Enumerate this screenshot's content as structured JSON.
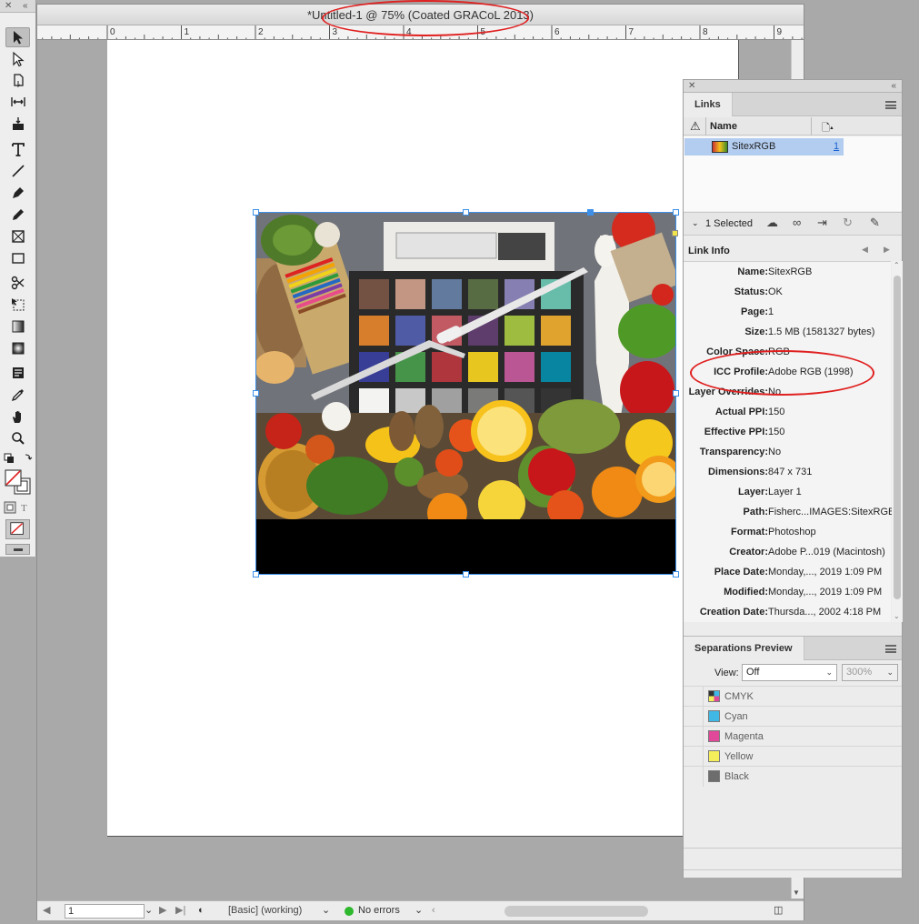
{
  "document": {
    "title": "*Untitled-1 @ 75% (Coated GRACoL 2013)",
    "ruler_ticks": [
      "0",
      "1",
      "2",
      "3",
      "4",
      "5",
      "6",
      "7",
      "8",
      "9"
    ]
  },
  "tools": [
    {
      "name": "selection-tool",
      "icon": "arrow-icon"
    },
    {
      "name": "direct-selection-tool",
      "icon": "hollow-arrow-icon"
    },
    {
      "name": "page-tool",
      "icon": "page-icon"
    },
    {
      "name": "gap-tool",
      "icon": "gap-icon"
    },
    {
      "name": "content-collector-tool",
      "icon": "collector-icon"
    },
    {
      "name": "type-tool",
      "icon": "type-icon"
    },
    {
      "name": "line-tool",
      "icon": "line-icon"
    },
    {
      "name": "pen-tool",
      "icon": "pen-icon"
    },
    {
      "name": "pencil-tool",
      "icon": "pencil-icon"
    },
    {
      "name": "rectangle-frame-tool",
      "icon": "frame-icon"
    },
    {
      "name": "rectangle-tool",
      "icon": "rectangle-icon"
    },
    {
      "name": "scissors-tool",
      "icon": "scissors-icon"
    },
    {
      "name": "free-transform-tool",
      "icon": "transform-icon"
    },
    {
      "name": "gradient-swatch-tool",
      "icon": "gradient-icon"
    },
    {
      "name": "gradient-feather-tool",
      "icon": "feather-icon"
    },
    {
      "name": "note-tool",
      "icon": "note-icon"
    },
    {
      "name": "eyedropper-tool",
      "icon": "eyedropper-icon"
    },
    {
      "name": "hand-tool",
      "icon": "hand-icon"
    },
    {
      "name": "zoom-tool",
      "icon": "zoom-icon"
    }
  ],
  "links_panel": {
    "tab": "Links",
    "column_name": "Name",
    "link": {
      "name": "SitexRGB",
      "page": "1"
    },
    "selected_label": "1 Selected",
    "link_info_label": "Link Info",
    "info": [
      {
        "key": "Name:",
        "value": "SitexRGB"
      },
      {
        "key": "Status:",
        "value": "OK"
      },
      {
        "key": "Page:",
        "value": "1"
      },
      {
        "key": "Size:",
        "value": "1.5 MB (1581327 bytes)"
      },
      {
        "key": "Color Space:",
        "value": "RGB"
      },
      {
        "key": "ICC Profile:",
        "value": "Adobe RGB (1998)"
      },
      {
        "key": "Layer Overrides:",
        "value": "No"
      },
      {
        "key": "Actual PPI:",
        "value": "150"
      },
      {
        "key": "Effective PPI:",
        "value": "150"
      },
      {
        "key": "Transparency:",
        "value": "No"
      },
      {
        "key": "Dimensions:",
        "value": "847 x 731"
      },
      {
        "key": "Layer:",
        "value": "Layer 1"
      },
      {
        "key": "Path:",
        "value": "Fisherc...IMAGES:SitexRGB"
      },
      {
        "key": "Format:",
        "value": "Photoshop"
      },
      {
        "key": "Creator:",
        "value": "Adobe P...019 (Macintosh)"
      },
      {
        "key": "Place Date:",
        "value": "Monday,..., 2019 1:09 PM"
      },
      {
        "key": "Modified:",
        "value": "Monday,..., 2019 1:09 PM"
      },
      {
        "key": "Creation Date:",
        "value": "Thursda..., 2002 4:18 PM"
      }
    ]
  },
  "separations_panel": {
    "tab": "Separations Preview",
    "view_label": "View:",
    "view_value": "Off",
    "zoom_value": "300%",
    "inks": [
      {
        "name": "CMYK",
        "color": "#cfcfcf"
      },
      {
        "name": "Cyan",
        "color": "#3fb8e6"
      },
      {
        "name": "Magenta",
        "color": "#e0499a"
      },
      {
        "name": "Yellow",
        "color": "#f4ee5a"
      },
      {
        "name": "Black",
        "color": "#6d6d6d"
      }
    ]
  },
  "status_bar": {
    "page_value": "1",
    "style": "[Basic] (working)",
    "preflight": "No errors",
    "preflight_color": "#2eb82e"
  }
}
